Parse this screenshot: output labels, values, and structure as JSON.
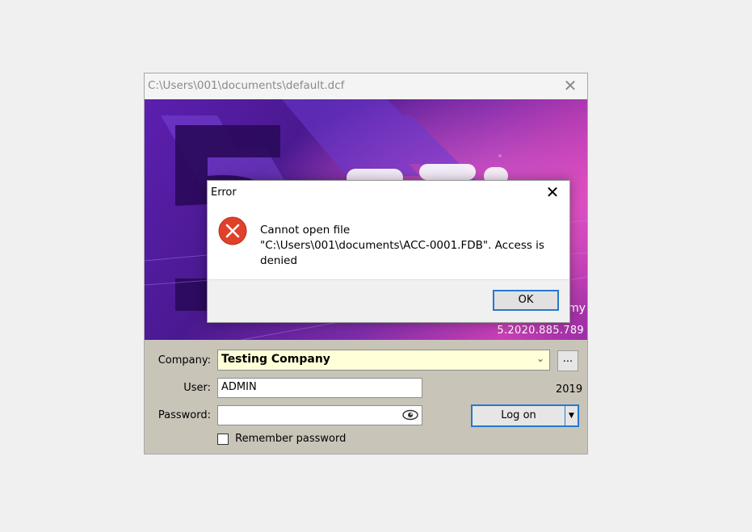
{
  "window": {
    "title": "C:\\Users\\001\\documents\\default.dcf",
    "close_glyph": "✕",
    "product_suffix": "my",
    "version": "5.2020.885.789"
  },
  "form": {
    "company_label": "Company:",
    "company_value": "Testing Company",
    "browse_label": "...",
    "year": "2019",
    "user_label": "User:",
    "user_value": "ADMIN",
    "password_label": "Password:",
    "password_value": "",
    "logon_label": "Log on",
    "remember_label": "Remember password",
    "remember_checked": false
  },
  "error_dialog": {
    "title": "Error",
    "close_glyph": "✕",
    "message": "Cannot open file\n\"C:\\Users\\001\\documents\\ACC-0001.FDB\". Access is\ndenied",
    "ok_label": "OK",
    "icon": "error-x-icon"
  },
  "colors": {
    "accent": "#2678d0",
    "error_icon": "#e0412a",
    "company_field_bg": "#ffffd8"
  }
}
